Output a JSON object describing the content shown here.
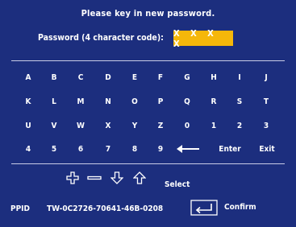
{
  "dialog": {
    "title": "Please key in new password.",
    "password_label": "Password (4 character code):",
    "password_value": "X X X X"
  },
  "keyboard": {
    "rows": [
      [
        "A",
        "B",
        "C",
        "D",
        "E",
        "F",
        "G",
        "H",
        "I",
        "J"
      ],
      [
        "K",
        "L",
        "M",
        "N",
        "O",
        "P",
        "Q",
        "R",
        "S",
        "T"
      ],
      [
        "U",
        "V",
        "W",
        "X",
        "Y",
        "Z",
        "0",
        "1",
        "2",
        "3"
      ],
      [
        "4",
        "5",
        "6",
        "7",
        "8",
        "9"
      ]
    ],
    "enter_label": "Enter",
    "exit_label": "Exit",
    "backspace_icon": "left-arrow-icon"
  },
  "controls": {
    "icons": [
      "plus-icon",
      "minus-icon",
      "down-arrow-icon",
      "up-arrow-icon"
    ],
    "select_label": "Select",
    "ppid_label": "PPID",
    "ppid_value": "TW-0C2726-70641-46B-0208",
    "confirm_icon": "enter-return-icon",
    "confirm_label": "Confirm"
  },
  "colors": {
    "background": "#1c2e7e",
    "highlight": "#f5b70a",
    "text": "#ffffff"
  }
}
